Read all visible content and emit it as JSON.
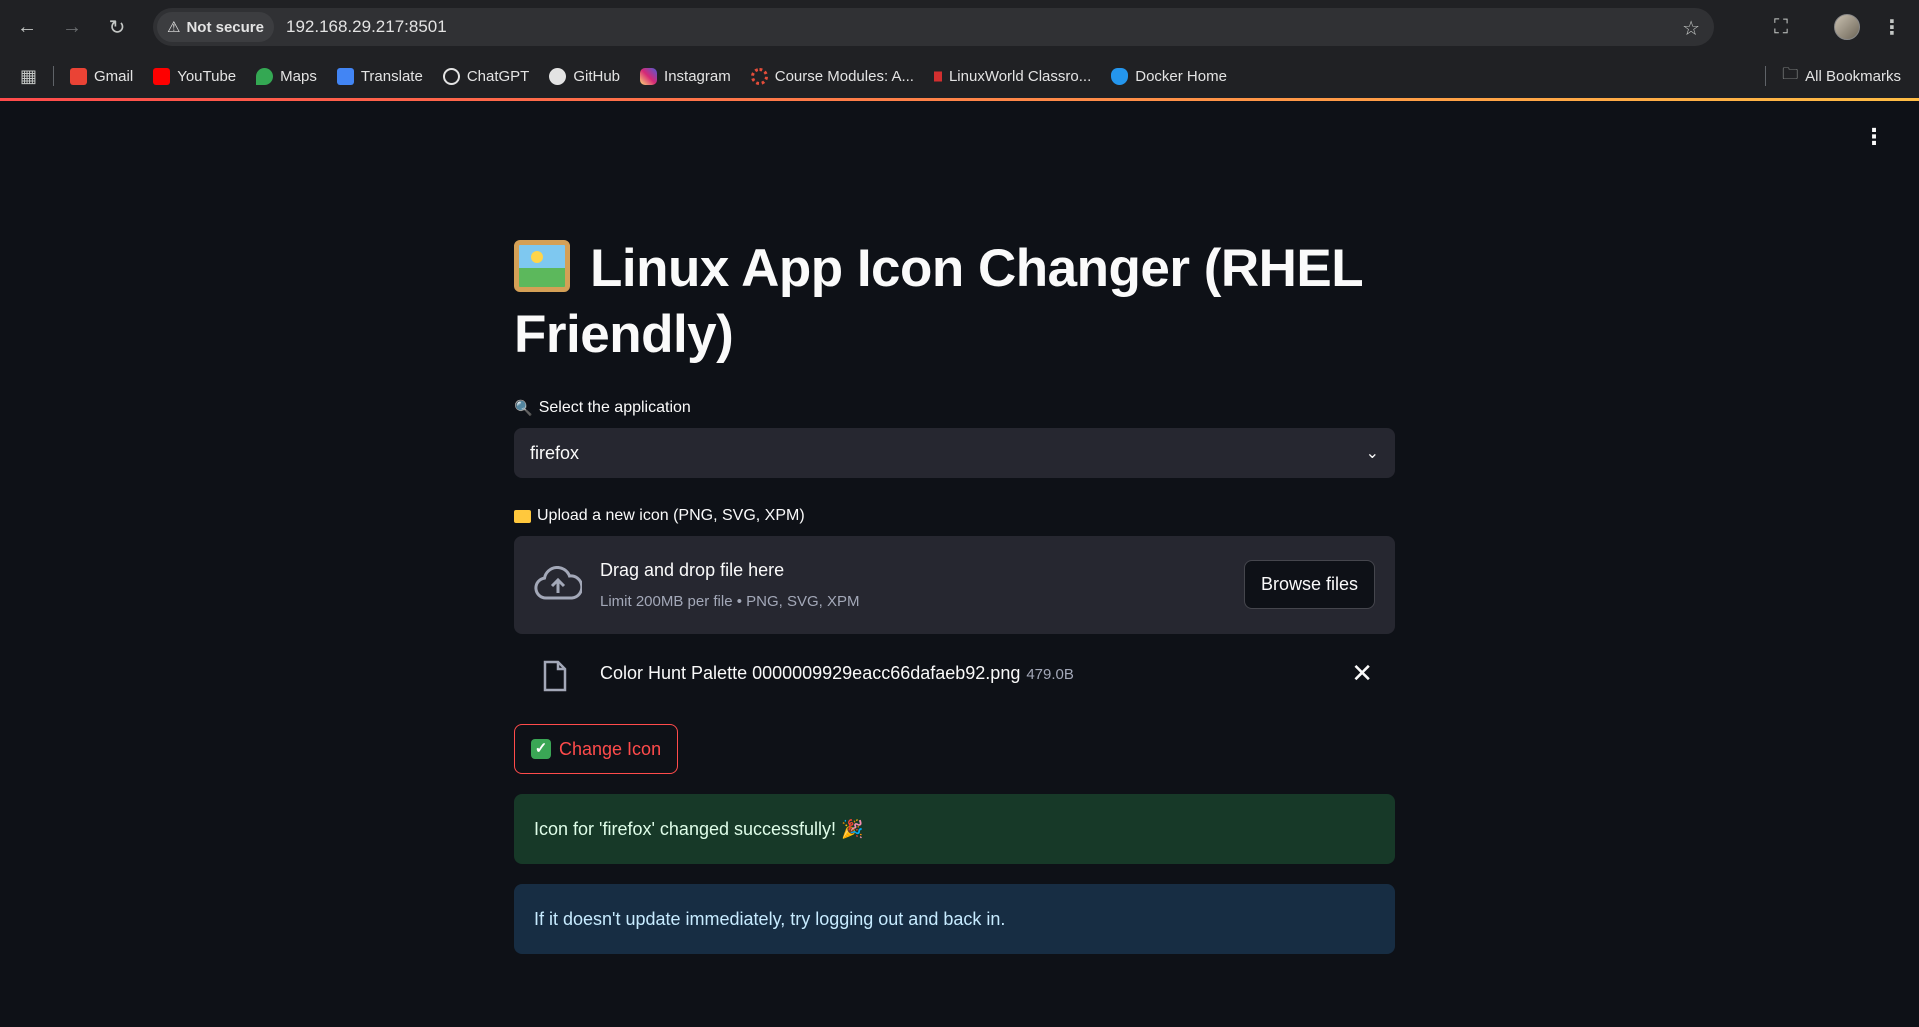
{
  "browser": {
    "security_label": "Not secure",
    "url": "192.168.29.217:8501",
    "bookmarks": [
      {
        "label": "Gmail",
        "color": "#ea4335"
      },
      {
        "label": "YouTube",
        "color": "#ff0000"
      },
      {
        "label": "Maps",
        "color": "#34a853"
      },
      {
        "label": "Translate",
        "color": "#4285f4"
      },
      {
        "label": "ChatGPT",
        "color": "#e3e3e3"
      },
      {
        "label": "GitHub",
        "color": "#e3e3e3"
      },
      {
        "label": "Instagram",
        "color": "#e1306c"
      },
      {
        "label": "Course Modules: A...",
        "color": "#e44d3a"
      },
      {
        "label": "LinuxWorld Classro...",
        "color": "#d32f2f"
      },
      {
        "label": "Docker Home",
        "color": "#2496ed"
      }
    ],
    "all_bookmarks": "All Bookmarks"
  },
  "app": {
    "title": "Linux App Icon Changer (RHEL Friendly)",
    "select_label": "Select the application",
    "selected_app": "firefox",
    "upload_label": "Upload a new icon (PNG, SVG, XPM)",
    "dropzone_title": "Drag and drop file here",
    "dropzone_sub": "Limit 200MB per file • PNG, SVG, XPM",
    "browse_label": "Browse files",
    "file_name": "Color Hunt Palette 0000009929eacc66dafaeb92.png",
    "file_size": "479.0B",
    "change_label": "Change Icon",
    "success_msg": "Icon for 'firefox' changed successfully! 🎉",
    "info_msg": "If it doesn't update immediately, try logging out and back in."
  },
  "colors": {
    "accent": "#ff4b4b",
    "background": "#0e1117",
    "success_bg": "#173928",
    "info_bg": "#172d43"
  }
}
